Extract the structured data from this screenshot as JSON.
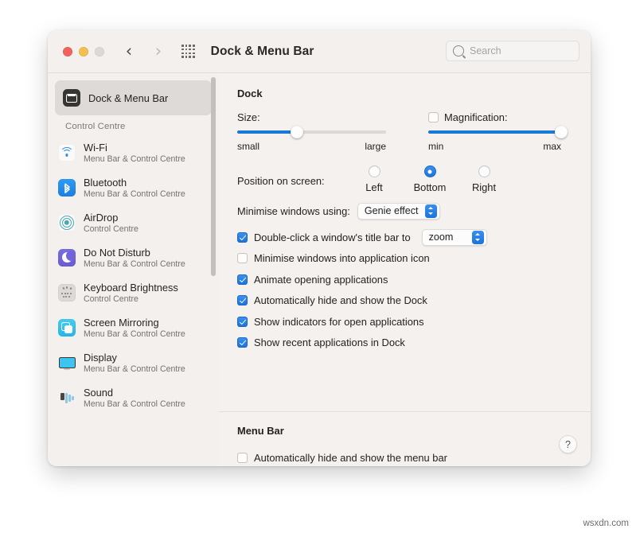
{
  "window": {
    "title": "Dock & Menu Bar",
    "traffic_lights": [
      "close",
      "minimize",
      "zoom"
    ],
    "nav": {
      "back": "‹",
      "forward": "›",
      "grid": "grid-icon"
    }
  },
  "search": {
    "value": "",
    "placeholder": "Search"
  },
  "sidebar": {
    "selected_item": {
      "label": "Dock & Menu Bar",
      "icon": "dock-menu-bar-icon"
    },
    "group_label": "Control Centre",
    "items": [
      {
        "label": "Wi-Fi",
        "sub": "Menu Bar & Control Centre",
        "icon": "wifi-icon"
      },
      {
        "label": "Bluetooth",
        "sub": "Menu Bar & Control Centre",
        "icon": "bluetooth-icon"
      },
      {
        "label": "AirDrop",
        "sub": "Control Centre",
        "icon": "airdrop-icon"
      },
      {
        "label": "Do Not Disturb",
        "sub": "Menu Bar & Control Centre",
        "icon": "do-not-disturb-icon"
      },
      {
        "label": "Keyboard Brightness",
        "sub": "Control Centre",
        "icon": "keyboard-brightness-icon"
      },
      {
        "label": "Screen Mirroring",
        "sub": "Menu Bar & Control Centre",
        "icon": "screen-mirroring-icon"
      },
      {
        "label": "Display",
        "sub": "Menu Bar & Control Centre",
        "icon": "display-icon"
      },
      {
        "label": "Sound",
        "sub": "Menu Bar & Control Centre",
        "icon": "sound-icon"
      }
    ]
  },
  "dock_section": {
    "title": "Dock",
    "size": {
      "label": "Size:",
      "min_label": "small",
      "max_label": "large",
      "value_percent": 40
    },
    "magnification": {
      "label": "Magnification:",
      "checked": false,
      "min_label": "min",
      "max_label": "max",
      "value_percent": 100
    },
    "position": {
      "label": "Position on screen:",
      "options": [
        "Left",
        "Bottom",
        "Right"
      ],
      "selected": "Bottom"
    },
    "minimise_using": {
      "label": "Minimise windows using:",
      "value": "Genie effect"
    },
    "double_click": {
      "label": "Double-click a window's title bar to",
      "checked": true,
      "value": "zoom"
    },
    "checkboxes": [
      {
        "label": "Minimise windows into application icon",
        "checked": false
      },
      {
        "label": "Animate opening applications",
        "checked": true
      },
      {
        "label": "Automatically hide and show the Dock",
        "checked": true
      },
      {
        "label": "Show indicators for open applications",
        "checked": true
      },
      {
        "label": "Show recent applications in Dock",
        "checked": true
      }
    ]
  },
  "menu_bar_section": {
    "title": "Menu Bar",
    "auto_hide": {
      "label": "Automatically hide and show the menu bar",
      "checked": false
    }
  },
  "help": {
    "label": "?"
  },
  "watermark": {
    "text": "wsxdn.com"
  },
  "colors": {
    "accent": "#1a74dd",
    "window_bg": "#f2efed",
    "sidebar_selected": "#dddad7"
  }
}
